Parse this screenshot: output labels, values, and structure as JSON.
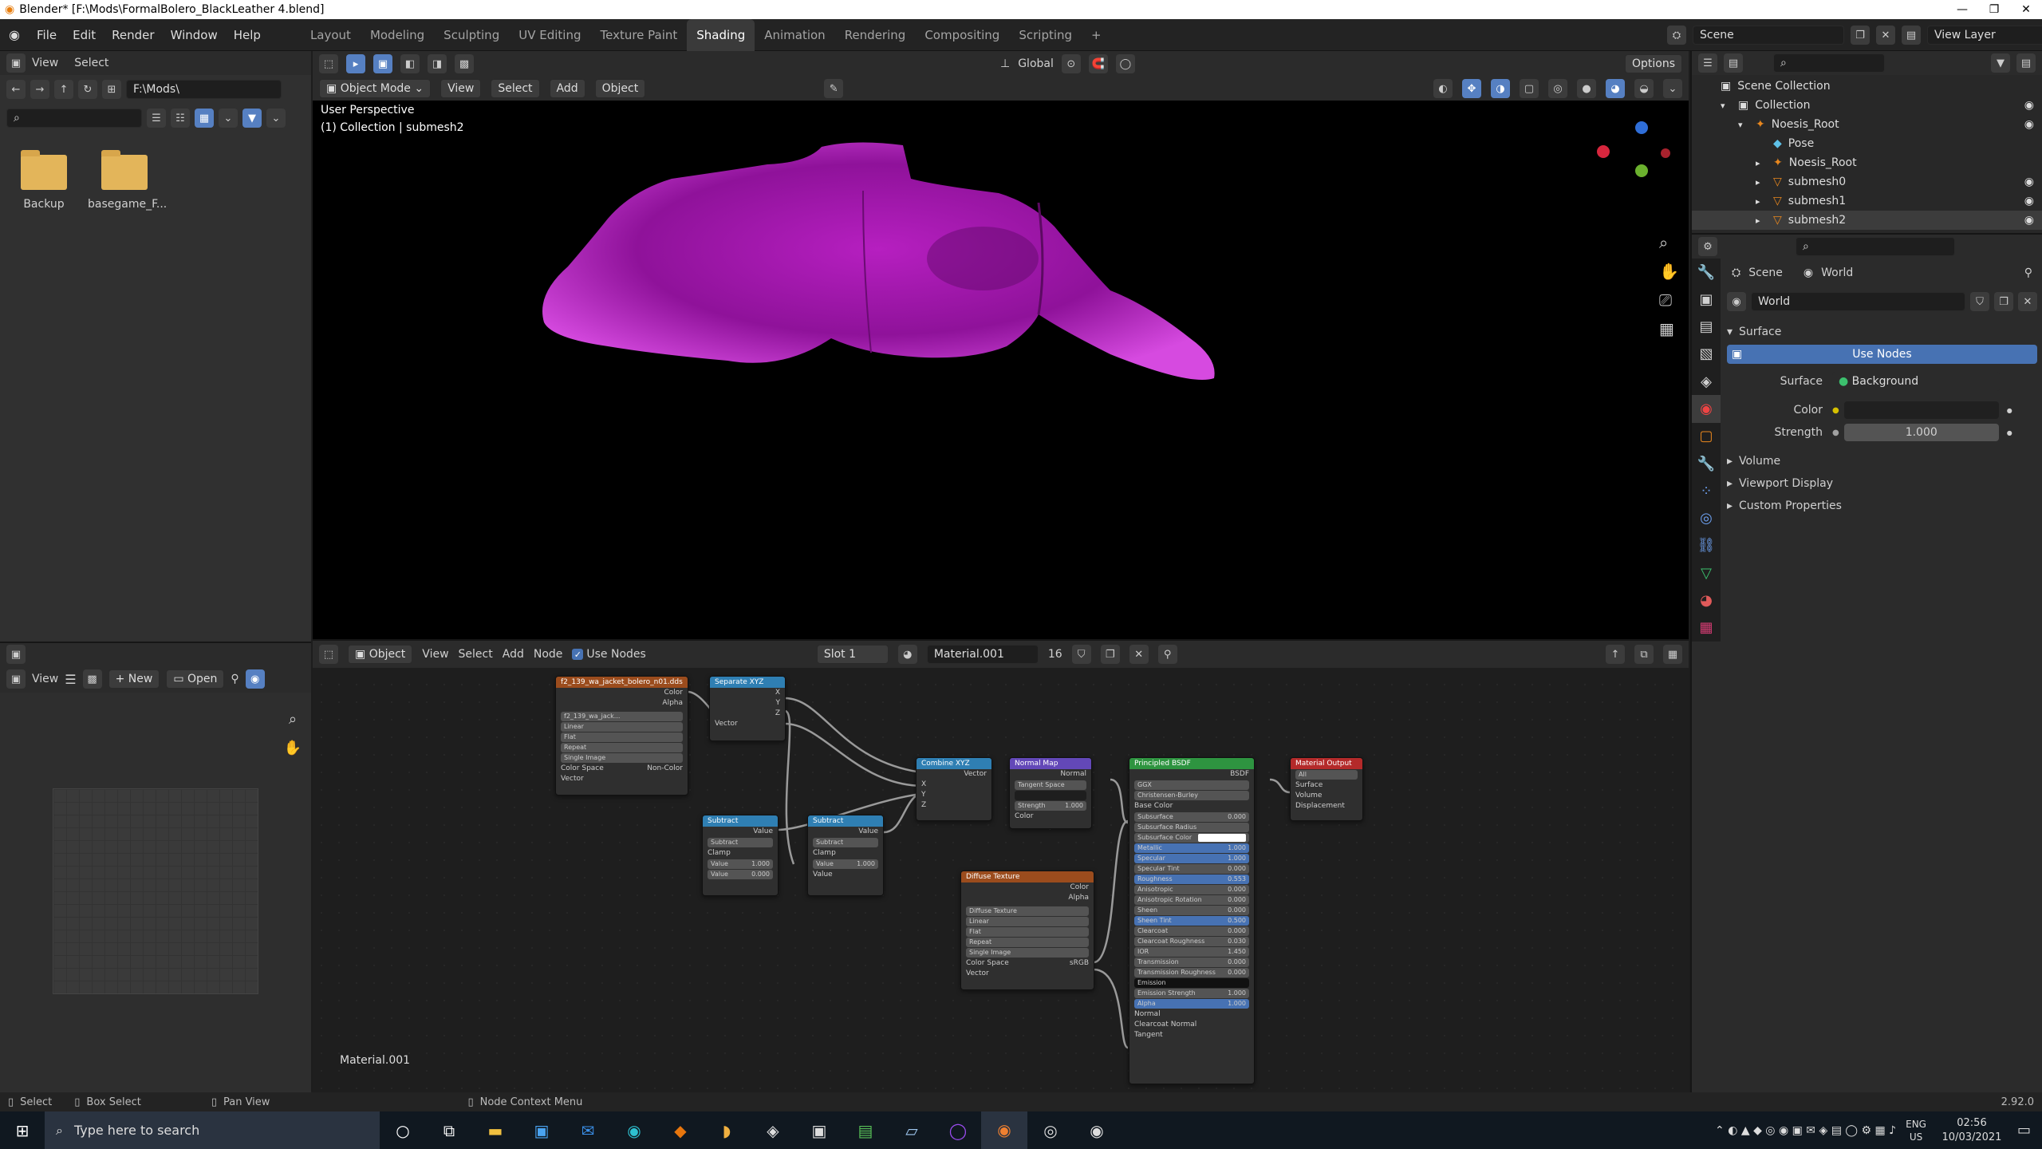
{
  "window": {
    "title": "Blender* [F:\\Mods\\FormalBolero_BlackLeather 4.blend]",
    "controls": [
      "—",
      "❐",
      "✕"
    ]
  },
  "menubar": {
    "items": [
      "File",
      "Edit",
      "Render",
      "Window",
      "Help"
    ],
    "workspaces": [
      "Layout",
      "Modeling",
      "Sculpting",
      "UV Editing",
      "Texture Paint",
      "Shading",
      "Animation",
      "Rendering",
      "Compositing",
      "Scripting"
    ],
    "active_workspace": "Shading",
    "add_tab": "+",
    "scene": "Scene",
    "view_layer": "View Layer"
  },
  "file_browser": {
    "menu": [
      "View",
      "Select"
    ],
    "path": "F:\\Mods\\",
    "folders": [
      "Backup",
      "basegame_F..."
    ]
  },
  "viewport": {
    "mode": "Object Mode",
    "menu": [
      "View",
      "Select",
      "Add",
      "Object"
    ],
    "transform": "Global",
    "options": "Options",
    "overlay_line1": "User Perspective",
    "overlay_line2": "(1) Collection | submesh2",
    "colors": {
      "mesh": "#c020c8",
      "background": "#000000"
    }
  },
  "image_editor": {
    "view": "View",
    "new": "New",
    "open": "Open"
  },
  "node_editor": {
    "type": "Object",
    "menu": [
      "View",
      "Select",
      "Add",
      "Node"
    ],
    "use_nodes": "Use Nodes",
    "slot": "Slot 1",
    "material": "Material.001",
    "users": "16",
    "material_label": "Material.001",
    "nodes": {
      "image_tex": {
        "title": "f2_139_wa_jacket_bolero_n01.dds",
        "out1": "Color",
        "out2": "Alpha",
        "img": "f2_139_wa_jack...",
        "interp": "Linear",
        "proj": "Flat",
        "ext": "Repeat",
        "src": "Single Image",
        "cs_label": "Color Space",
        "cs": "Non-Color",
        "vec": "Vector"
      },
      "separate": {
        "title": "Separate XYZ",
        "x": "X",
        "y": "Y",
        "z": "Z",
        "vec": "Vector"
      },
      "subtract1": {
        "title": "Subtract",
        "out": "Value",
        "op": "Subtract",
        "clamp": "Clamp",
        "v_label": "Value",
        "v1": "1.000",
        "v2": "0.000"
      },
      "subtract2": {
        "title": "Subtract",
        "out": "Value",
        "op": "Subtract",
        "clamp": "Clamp",
        "v_label": "Value",
        "v1": "1.000",
        "v2_label": "Value"
      },
      "combine": {
        "title": "Combine XYZ",
        "out": "Vector",
        "x": "X",
        "y": "Y",
        "z": "Z"
      },
      "normalmap": {
        "title": "Normal Map",
        "out": "Normal",
        "space": "Tangent Space",
        "strength_label": "Strength",
        "strength": "1.000",
        "color": "Color"
      },
      "diffuse": {
        "title": "Diffuse Texture",
        "out1": "Color",
        "out2": "Alpha",
        "img": "Diffuse Texture",
        "interp": "Linear",
        "proj": "Flat",
        "ext": "Repeat",
        "src": "Single Image",
        "cs_label": "Color Space",
        "cs": "sRGB",
        "vec": "Vector"
      },
      "bsdf": {
        "title": "Principled BSDF",
        "out": "BSDF",
        "dist": "GGX",
        "sss": "Christensen-Burley",
        "rows": [
          {
            "label": "Base Color",
            "value": "",
            "kind": "socket"
          },
          {
            "label": "Subsurface",
            "value": "0.000",
            "kind": "field"
          },
          {
            "label": "Subsurface Radius",
            "value": "",
            "kind": "field"
          },
          {
            "label": "Subsurface Color",
            "value": "",
            "kind": "color"
          },
          {
            "label": "Metallic",
            "value": "1.000",
            "kind": "blue"
          },
          {
            "label": "Specular",
            "value": "1.000",
            "kind": "blue"
          },
          {
            "label": "Specular Tint",
            "value": "0.000",
            "kind": "field"
          },
          {
            "label": "Roughness",
            "value": "0.553",
            "kind": "blue"
          },
          {
            "label": "Anisotropic",
            "value": "0.000",
            "kind": "field"
          },
          {
            "label": "Anisotropic Rotation",
            "value": "0.000",
            "kind": "field"
          },
          {
            "label": "Sheen",
            "value": "0.000",
            "kind": "field"
          },
          {
            "label": "Sheen Tint",
            "value": "0.500",
            "kind": "blue"
          },
          {
            "label": "Clearcoat",
            "value": "0.000",
            "kind": "field"
          },
          {
            "label": "Clearcoat Roughness",
            "value": "0.030",
            "kind": "field"
          },
          {
            "label": "IOR",
            "value": "1.450",
            "kind": "field"
          },
          {
            "label": "Transmission",
            "value": "0.000",
            "kind": "field"
          },
          {
            "label": "Transmission Roughness",
            "value": "0.000",
            "kind": "field"
          },
          {
            "label": "Emission",
            "value": "",
            "kind": "dark"
          },
          {
            "label": "Emission Strength",
            "value": "1.000",
            "kind": "field"
          },
          {
            "label": "Alpha",
            "value": "1.000",
            "kind": "blue"
          },
          {
            "label": "Normal",
            "value": "",
            "kind": "socket"
          },
          {
            "label": "Clearcoat Normal",
            "value": "",
            "kind": "socket"
          },
          {
            "label": "Tangent",
            "value": "",
            "kind": "socket"
          }
        ]
      },
      "output": {
        "title": "Material Output",
        "target": "All",
        "s1": "Surface",
        "s2": "Volume",
        "s3": "Displacement"
      }
    }
  },
  "outliner": {
    "items": [
      {
        "label": "Scene Collection",
        "indent": 0
      },
      {
        "label": "Collection",
        "indent": 1
      },
      {
        "label": "Noesis_Root",
        "indent": 2
      },
      {
        "label": "Pose",
        "indent": 3
      },
      {
        "label": "Noesis_Root",
        "indent": 3
      },
      {
        "label": "submesh0",
        "indent": 3
      },
      {
        "label": "submesh1",
        "indent": 3
      },
      {
        "label": "submesh2",
        "indent": 3
      }
    ]
  },
  "properties": {
    "breadcrumb": [
      "Scene",
      "World"
    ],
    "world_name": "World",
    "surface_section": "Surface",
    "use_nodes": "Use Nodes",
    "surface_label": "Surface",
    "surface_value": "Background",
    "color_label": "Color",
    "strength_label": "Strength",
    "strength_value": "1.000",
    "sections": [
      "Volume",
      "Viewport Display",
      "Custom Properties"
    ]
  },
  "statusbar": {
    "select": "Select",
    "box_select": "Box Select",
    "pan": "Pan View",
    "context": "Node Context Menu",
    "version": "2.92.0"
  },
  "taskbar": {
    "search": "Type here to search",
    "lang1": "ENG",
    "lang2": "US",
    "time": "02:56",
    "date": "10/03/2021"
  }
}
